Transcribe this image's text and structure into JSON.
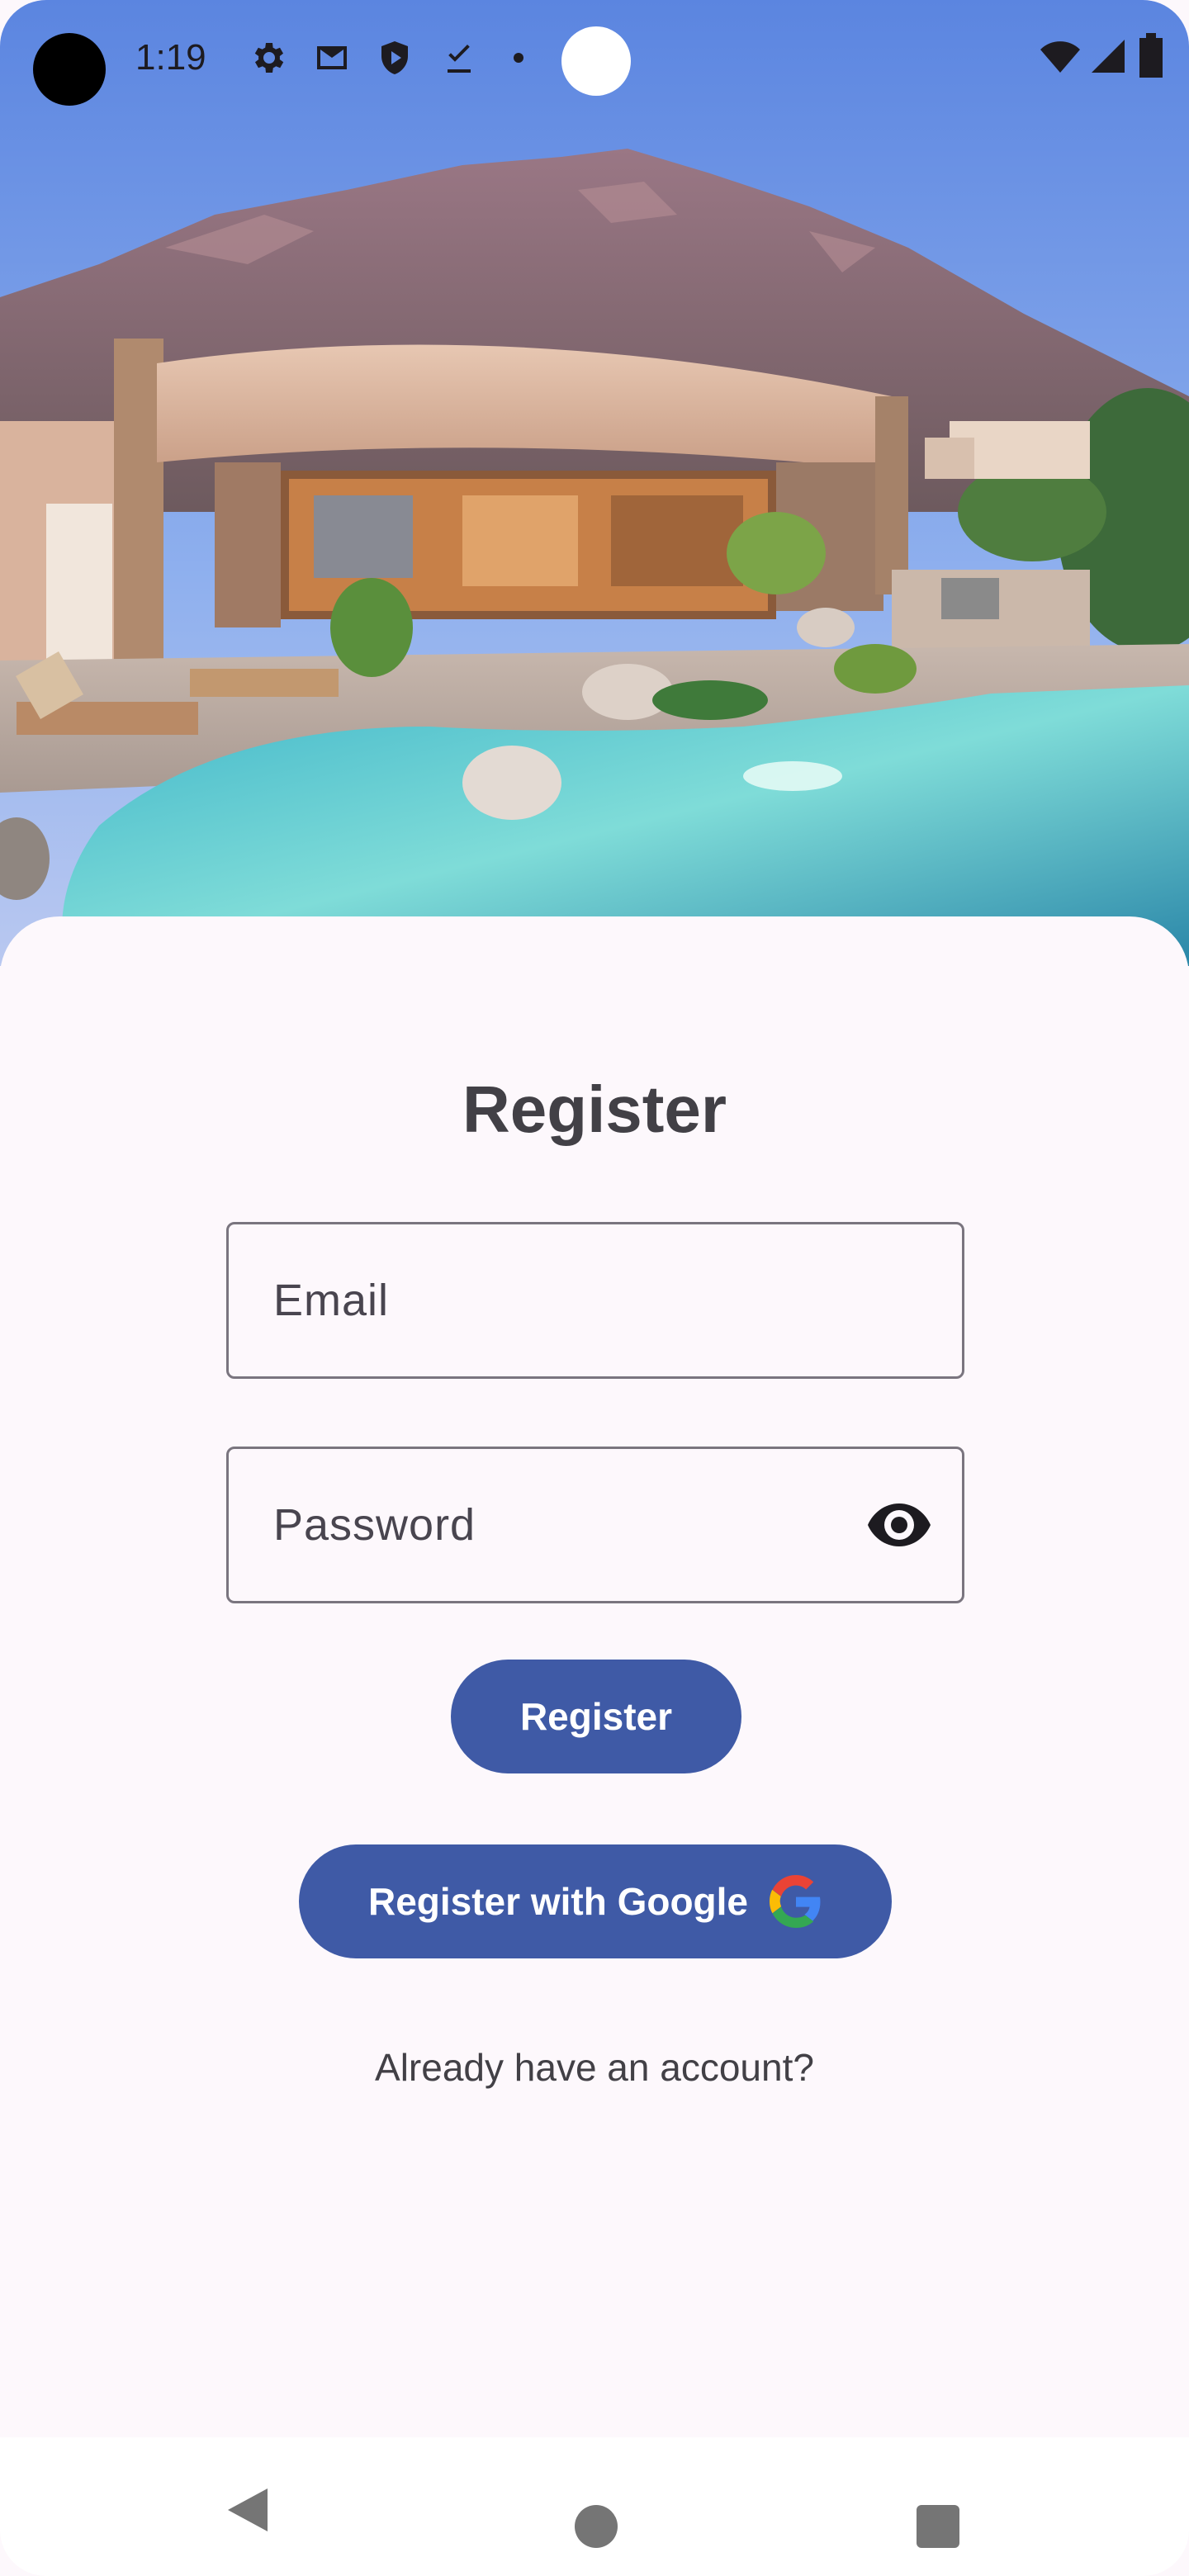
{
  "status_bar": {
    "time": "1:19",
    "left_icons": [
      "gear-icon",
      "mail-icon",
      "shield-icon",
      "download-check-icon",
      "dot-icon"
    ],
    "right_icons": [
      "wifi-icon",
      "signal-icon",
      "battery-icon"
    ]
  },
  "hero": {
    "image_icon": "luxury-house-pool-image"
  },
  "form": {
    "title": "Register",
    "email_placeholder": "Email",
    "password_placeholder": "Password",
    "password_toggle_icon": "eye-icon",
    "register_button": "Register",
    "google_button": "Register with Google",
    "google_icon": "google-icon",
    "login_link": "Already have an account?"
  },
  "colors": {
    "primary": "#3f5aa6",
    "background": "#fdf8fc",
    "text": "#424046"
  },
  "nav_bar": {
    "icons": [
      "back-icon",
      "home-icon",
      "recents-icon"
    ]
  }
}
